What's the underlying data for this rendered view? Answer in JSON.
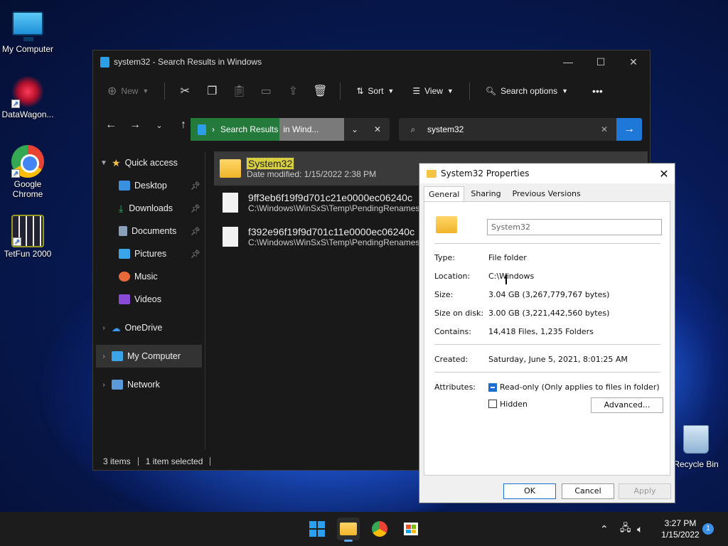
{
  "desktop": {
    "icons": [
      {
        "label": "My Computer"
      },
      {
        "label": "DataWagon..."
      },
      {
        "label": "Google Chrome"
      },
      {
        "label": "TetFun 2000"
      },
      {
        "label": "Recycle Bin"
      }
    ]
  },
  "explorer": {
    "title": "system32 - Search Results in Windows",
    "toolbar": {
      "new_label": "New",
      "sort_label": "Sort",
      "view_label": "View",
      "search_options_label": "Search options",
      "more_label": "•••"
    },
    "address": {
      "highlighted": "Search Results",
      "rest": "in Wind..."
    },
    "search": {
      "value": "system32"
    },
    "nav": {
      "quick_access": "Quick access",
      "items": [
        {
          "label": "Desktop",
          "icon": "desktop-icon",
          "color": "#3a8fe0"
        },
        {
          "label": "Downloads",
          "icon": "download-icon",
          "color": "#2fb36a"
        },
        {
          "label": "Documents",
          "icon": "documents-icon",
          "color": "#8aa0b8"
        },
        {
          "label": "Pictures",
          "icon": "pictures-icon",
          "color": "#3aa6e8"
        },
        {
          "label": "Music",
          "icon": "music-icon",
          "color": "#e86a3a"
        },
        {
          "label": "Videos",
          "icon": "videos-icon",
          "color": "#8a4ad8"
        }
      ],
      "onedrive": "OneDrive",
      "my_computer": "My Computer",
      "network": "Network"
    },
    "results": [
      {
        "name": "System32",
        "detail": "Date modified: 1/15/2022 2:38 PM",
        "type": "folder"
      },
      {
        "name": "9ff3eb6f19f9d701c21e0000ec06240c",
        "detail": "C:\\Windows\\WinSxS\\Temp\\PendingRenames",
        "type": "file"
      },
      {
        "name": "f392e96f19f9d701c11e0000ec06240c",
        "detail": "C:\\Windows\\WinSxS\\Temp\\PendingRenames",
        "type": "file"
      }
    ],
    "status": {
      "items": "3 items",
      "selected": "1 item selected"
    }
  },
  "dialog": {
    "title": "System32 Properties",
    "tabs": [
      "General",
      "Sharing",
      "Previous Versions"
    ],
    "name": "System32",
    "type_k": "Type:",
    "type_v": "File folder",
    "location_k": "Location:",
    "location_v": "C:\\Windows",
    "size_k": "Size:",
    "size_v": "3.04 GB (3,267,779,767 bytes)",
    "sod_k": "Size on disk:",
    "sod_v": "3.00 GB (3,221,442,560 bytes)",
    "contains_k": "Contains:",
    "contains_v": "14,418 Files, 1,235 Folders",
    "created_k": "Created:",
    "created_v": "Saturday, June 5, 2021, 8:01:25 AM",
    "attributes_k": "Attributes:",
    "readonly_label": "Read-only (Only applies to files in folder)",
    "hidden_label": "Hidden",
    "advanced_label": "Advanced...",
    "ok_label": "OK",
    "cancel_label": "Cancel",
    "apply_label": "Apply"
  },
  "taskbar": {
    "time": "3:27 PM",
    "date": "1/15/2022",
    "notifications": "1"
  }
}
